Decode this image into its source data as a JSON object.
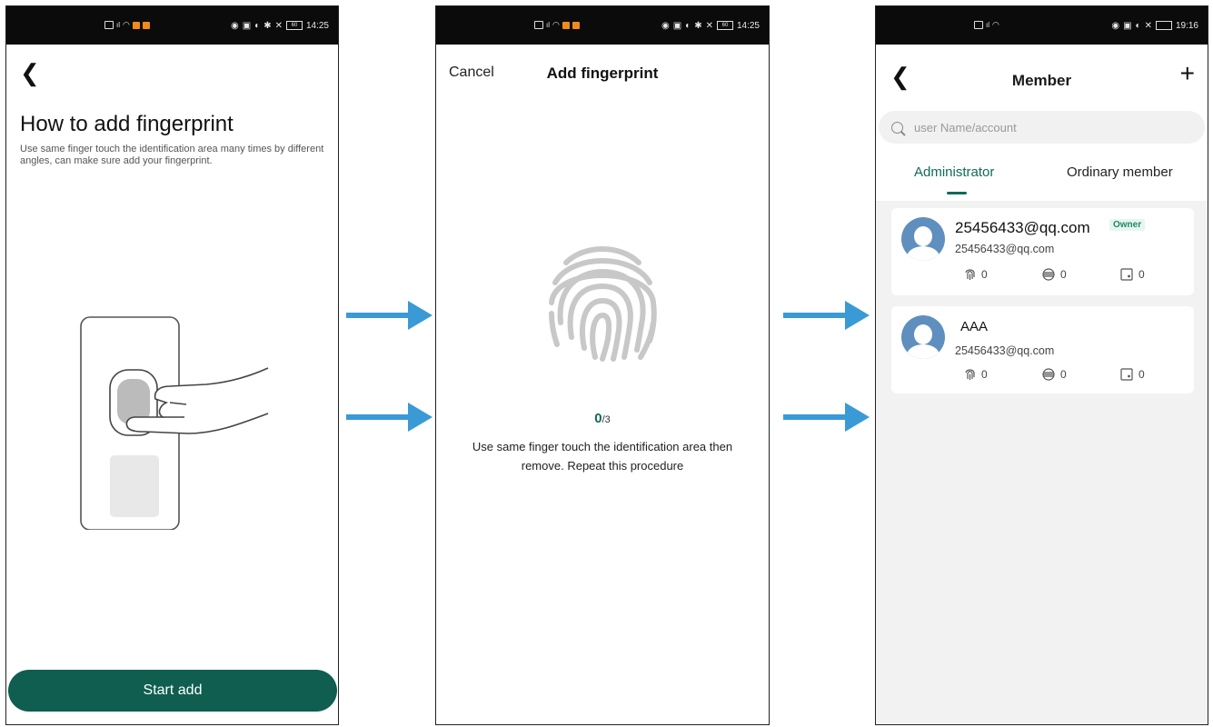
{
  "status_bar": {
    "time1": "14:25",
    "time2": "14:25",
    "time3": "19:16",
    "battery": "60"
  },
  "screen1": {
    "title": "How to add fingerprint",
    "description": "Use same finger touch the identification area many times by different angles, can make sure add your fingerprint.",
    "start_button": "Start add"
  },
  "screen2": {
    "cancel": "Cancel",
    "title": "Add fingerprint",
    "progress_current": "0",
    "progress_total": "/3",
    "instruction": "Use same finger touch the identification area then remove. Repeat this procedure"
  },
  "screen3": {
    "title": "Member",
    "add_icon": "+",
    "search_placeholder": "user Name/account",
    "tabs": [
      "Administrator",
      "Ordinary member"
    ],
    "members": [
      {
        "name": "25456433@qq.com",
        "badge": "Owner",
        "email": "25456433@qq.com",
        "fingerprint": "0",
        "card": "0",
        "password": "0"
      },
      {
        "name": "AAA",
        "email": "25456433@qq.com",
        "fingerprint": "0",
        "card": "0",
        "password": "0"
      }
    ]
  },
  "colors": {
    "primary": "#0f5e50",
    "accent": "#0f6b58",
    "arrow": "#3a9ad6",
    "avatar": "#5f8fbe"
  }
}
